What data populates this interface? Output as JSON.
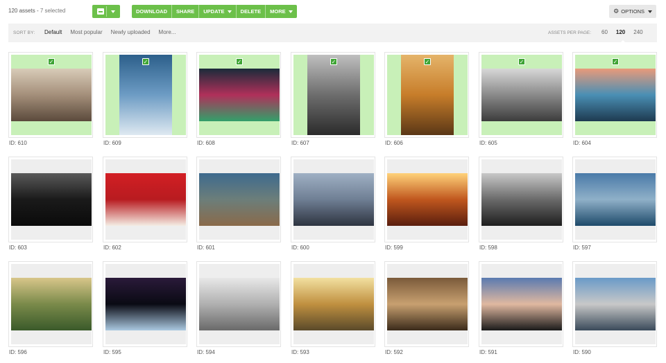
{
  "toolbar": {
    "asset_count": "120 assets",
    "separator": "-",
    "selected_count": "7 selected",
    "actions": [
      {
        "label": "DOWNLOAD",
        "caret": false
      },
      {
        "label": "SHARE",
        "caret": false
      },
      {
        "label": "UPDATE",
        "caret": true
      },
      {
        "label": "DELETE",
        "caret": false
      },
      {
        "label": "MORE",
        "caret": true
      }
    ],
    "options_label": "OPTIONS",
    "options_icon": "gear-icon",
    "select_icon": "select-all-checkbox-icon"
  },
  "sortbar": {
    "sort_label": "SORT BY:",
    "sort_options": [
      "Default",
      "Most popular",
      "Newly uploaded",
      "More..."
    ],
    "active_sort": "Default",
    "per_page_label": "ASSETS PER PAGE:",
    "per_page_options": [
      "60",
      "120",
      "240"
    ],
    "active_per_page": "120"
  },
  "colors": {
    "accent": "#6cc04a",
    "selected_bg": "#c8f0b8",
    "check": "#3fa535"
  },
  "assets": [
    {
      "id": "ID: 610",
      "selected": true,
      "orientation": "landscape",
      "colors": [
        "#d8cbb8",
        "#a48f7a",
        "#5b4a3c"
      ]
    },
    {
      "id": "ID: 609",
      "selected": true,
      "orientation": "portrait",
      "colors": [
        "#2c5f8a",
        "#6d9cc4",
        "#dfe9f1"
      ]
    },
    {
      "id": "ID: 608",
      "selected": true,
      "orientation": "landscape",
      "colors": [
        "#1b2b3a",
        "#b0305a",
        "#33a06a"
      ]
    },
    {
      "id": "ID: 607",
      "selected": true,
      "orientation": "portrait",
      "colors": [
        "#bfbfbf",
        "#6d6d6d",
        "#2b2b2b"
      ]
    },
    {
      "id": "ID: 606",
      "selected": true,
      "orientation": "portrait",
      "colors": [
        "#e5b46a",
        "#c77d2a",
        "#5a3716"
      ]
    },
    {
      "id": "ID: 605",
      "selected": true,
      "orientation": "landscape",
      "colors": [
        "#d7d7d7",
        "#8a8a8a",
        "#3c3c3c"
      ]
    },
    {
      "id": "ID: 604",
      "selected": true,
      "orientation": "landscape",
      "colors": [
        "#e99a7a",
        "#4a8fb4",
        "#1e3a50"
      ]
    },
    {
      "id": "ID: 603",
      "selected": false,
      "orientation": "landscape",
      "colors": [
        "#5a5a5a",
        "#1a1a1a",
        "#0a0a0a"
      ]
    },
    {
      "id": "ID: 602",
      "selected": false,
      "orientation": "landscape",
      "colors": [
        "#d21f24",
        "#b81b20",
        "#f4ede4"
      ]
    },
    {
      "id": "ID: 601",
      "selected": false,
      "orientation": "landscape",
      "colors": [
        "#3e6a8e",
        "#6c7e7a",
        "#8a6a4a"
      ]
    },
    {
      "id": "ID: 600",
      "selected": false,
      "orientation": "landscape",
      "colors": [
        "#9fb0c4",
        "#6f7f94",
        "#2e3440"
      ]
    },
    {
      "id": "ID: 599",
      "selected": false,
      "orientation": "landscape",
      "colors": [
        "#ffd27a",
        "#c0571e",
        "#5a1e0e"
      ]
    },
    {
      "id": "ID: 598",
      "selected": false,
      "orientation": "landscape",
      "colors": [
        "#c8c8c8",
        "#6a6a6a",
        "#1e1e1e"
      ]
    },
    {
      "id": "ID: 597",
      "selected": false,
      "orientation": "landscape",
      "colors": [
        "#4a7aa8",
        "#8fb0c8",
        "#1e4a6a"
      ]
    },
    {
      "id": "ID: 596",
      "selected": false,
      "orientation": "landscape",
      "colors": [
        "#d8c68a",
        "#7a8a4a",
        "#3a5a2a"
      ]
    },
    {
      "id": "ID: 595",
      "selected": false,
      "orientation": "landscape",
      "colors": [
        "#2a1a3a",
        "#0a0a14",
        "#aac8e0"
      ]
    },
    {
      "id": "ID: 594",
      "selected": false,
      "orientation": "landscape",
      "colors": [
        "#e8e8e8",
        "#b0b0b0",
        "#6a6a6a"
      ]
    },
    {
      "id": "ID: 593",
      "selected": false,
      "orientation": "landscape",
      "colors": [
        "#f2e0a0",
        "#c09040",
        "#5a4a2a"
      ]
    },
    {
      "id": "ID: 592",
      "selected": false,
      "orientation": "landscape",
      "colors": [
        "#7a5a3a",
        "#c8a070",
        "#3a2a1a"
      ]
    },
    {
      "id": "ID: 591",
      "selected": false,
      "orientation": "landscape",
      "colors": [
        "#5a7ab0",
        "#e0b8a0",
        "#1a1a1a"
      ]
    },
    {
      "id": "ID: 590",
      "selected": false,
      "orientation": "landscape",
      "colors": [
        "#6a9ac8",
        "#c8c8c8",
        "#3a4a5a"
      ]
    }
  ]
}
